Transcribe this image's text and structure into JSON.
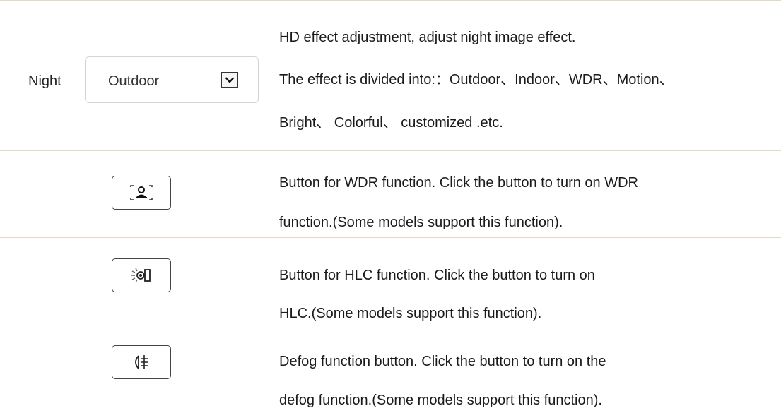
{
  "rows": [
    {
      "control": {
        "label": "Night",
        "select_value": "Outdoor",
        "arrow_icon": "chevron-down-icon"
      },
      "description": [
        "HD effect adjustment, adjust night image effect.",
        "The effect is divided into:：Outdoor、Indoor、WDR、Motion、",
        "Bright、 Colorful、 customized .etc."
      ]
    },
    {
      "control": {
        "icon": "wdr-portrait-icon"
      },
      "description": [
        "Button for WDR function. Click the button to turn on WDR",
        "function.(Some models support this function)."
      ]
    },
    {
      "control": {
        "icon": "hlc-light-icon"
      },
      "description": [
        "Button for HLC function. Click the button to turn on",
        "HLC.(Some models support this function)."
      ]
    },
    {
      "control": {
        "icon": "defog-lamp-icon"
      },
      "description": [
        "Defog function button. Click the button to turn on the",
        "defog function.(Some models support this function)."
      ]
    }
  ],
  "colors": {
    "grid": "#e3d9c2",
    "text": "#1a1a1a",
    "button_border": "#444444"
  }
}
